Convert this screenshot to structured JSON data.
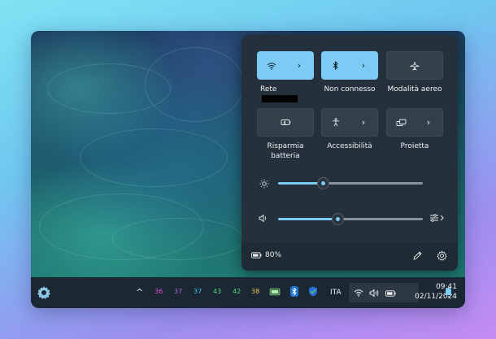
{
  "quick_settings": {
    "tiles": [
      {
        "id": "wifi",
        "label": "Rete",
        "active": true,
        "has_chevron": true,
        "icon": "wifi-icon",
        "chevron": "›"
      },
      {
        "id": "bluetooth",
        "label": "Non connesso",
        "active": true,
        "has_chevron": true,
        "icon": "bluetooth-icon",
        "chevron": "›"
      },
      {
        "id": "airplane",
        "label": "Modalità aereo",
        "active": false,
        "has_chevron": false,
        "icon": "airplane-icon"
      },
      {
        "id": "battery-saver",
        "label": "Risparmia\nbatteria",
        "active": false,
        "has_chevron": false,
        "icon": "battery-saver-icon"
      },
      {
        "id": "accessibility",
        "label": "Accessibilità",
        "active": false,
        "has_chevron": true,
        "icon": "accessibility-icon",
        "chevron": "›"
      },
      {
        "id": "project",
        "label": "Proietta",
        "active": false,
        "has_chevron": true,
        "icon": "project-icon",
        "chevron": "›"
      }
    ],
    "label_line1": "Risparmia",
    "label_line2": "batteria",
    "brightness": {
      "level": 0.31,
      "icon": "brightness-icon"
    },
    "volume": {
      "level": 0.41,
      "icon": "speaker-icon",
      "output_icon": "audio-output-icon"
    },
    "battery_percent": "80%",
    "footer_icons": [
      "battery-icon",
      "edit-icon",
      "settings-icon"
    ]
  },
  "taskbar": {
    "overflow_chevron": "^",
    "tray_numbers": [
      {
        "value": "36",
        "color": "#e04fd2"
      },
      {
        "value": "37",
        "color": "#b06ae8"
      },
      {
        "value": "37",
        "color": "#3ec6e8"
      },
      {
        "value": "43",
        "color": "#4fd67a"
      },
      {
        "value": "42",
        "color": "#4fd67a"
      },
      {
        "value": "38",
        "color": "#e8c84a"
      }
    ],
    "language": "ITA",
    "time": "09:41",
    "date": "02/11/2024",
    "accent_color": "#7ccbf5"
  }
}
